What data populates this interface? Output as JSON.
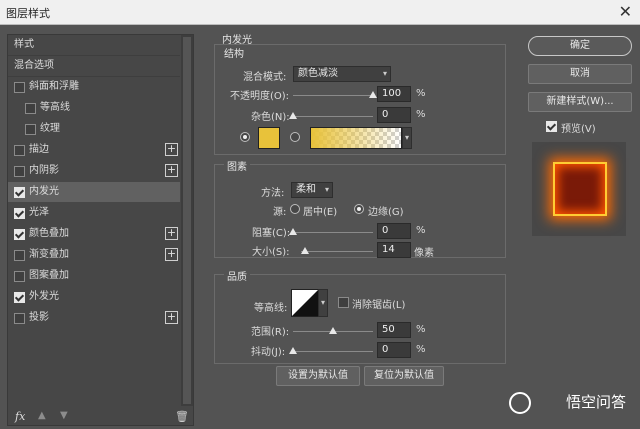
{
  "window": {
    "title": "图层样式"
  },
  "sidebar": {
    "items": [
      {
        "label": "样式",
        "checkbox": false,
        "plus": false,
        "selected": false
      },
      {
        "label": "混合选项",
        "checkbox": false,
        "plus": false,
        "selected": false
      },
      {
        "label": "斜面和浮雕",
        "checkbox": true,
        "checked": false,
        "plus": false,
        "selected": false
      },
      {
        "label": "等高线",
        "checkbox": true,
        "checked": false,
        "plus": false,
        "indent": true
      },
      {
        "label": "纹理",
        "checkbox": true,
        "checked": false,
        "plus": false,
        "indent": true
      },
      {
        "label": "描边",
        "checkbox": true,
        "checked": false,
        "plus": true
      },
      {
        "label": "内阴影",
        "checkbox": true,
        "checked": false,
        "plus": true
      },
      {
        "label": "内发光",
        "checkbox": true,
        "checked": true,
        "plus": false,
        "selected": true
      },
      {
        "label": "光泽",
        "checkbox": true,
        "checked": true,
        "plus": false
      },
      {
        "label": "颜色叠加",
        "checkbox": true,
        "checked": true,
        "plus": true
      },
      {
        "label": "渐变叠加",
        "checkbox": true,
        "checked": false,
        "plus": true
      },
      {
        "label": "图案叠加",
        "checkbox": true,
        "checked": false,
        "plus": false
      },
      {
        "label": "外发光",
        "checkbox": true,
        "checked": true,
        "plus": false
      },
      {
        "label": "投影",
        "checkbox": true,
        "checked": false,
        "plus": true
      }
    ],
    "footer": {
      "fx_label": "fx",
      "up_icon": "up-arrow-icon",
      "down_icon": "down-arrow-icon",
      "trash_icon": "trash-icon"
    }
  },
  "panel": {
    "title": "内发光",
    "structure": {
      "heading": "结构",
      "blend_mode_label": "混合模式:",
      "blend_mode_value": "颜色减淡",
      "opacity_label": "不透明度(O):",
      "opacity_value": "100",
      "opacity_fraction": 1.0,
      "noise_label": "杂色(N):",
      "noise_value": "0",
      "noise_fraction": 0.0,
      "percent": "%",
      "color_hex": "#e8c23a"
    },
    "elements": {
      "heading": "图素",
      "method_label": "方法:",
      "method_value": "柔和",
      "source_label": "源:",
      "source_center": "居中(E)",
      "source_edge": "边缘(G)",
      "choke_label": "阻塞(C):",
      "choke_value": "0",
      "choke_fraction": 0.0,
      "size_label": "大小(S):",
      "size_value": "14",
      "size_fraction": 0.056,
      "size_unit": "像素",
      "percent": "%"
    },
    "quality": {
      "heading": "品质",
      "contour_label": "等高线:",
      "antialias_label": "消除锯齿(L)",
      "range_label": "范围(R):",
      "range_value": "50",
      "range_fraction": 0.5,
      "jitter_label": "抖动(J):",
      "jitter_value": "0",
      "jitter_fraction": 0.0,
      "percent": "%"
    },
    "buttons": {
      "make_default": "设置为默认值",
      "reset_default": "复位为默认值"
    }
  },
  "actions": {
    "ok": "确定",
    "cancel": "取消",
    "new_style": "新建样式(W)...",
    "preview_label": "预览(V)",
    "preview_checked": true
  },
  "watermark": {
    "text": "悟空问答"
  }
}
